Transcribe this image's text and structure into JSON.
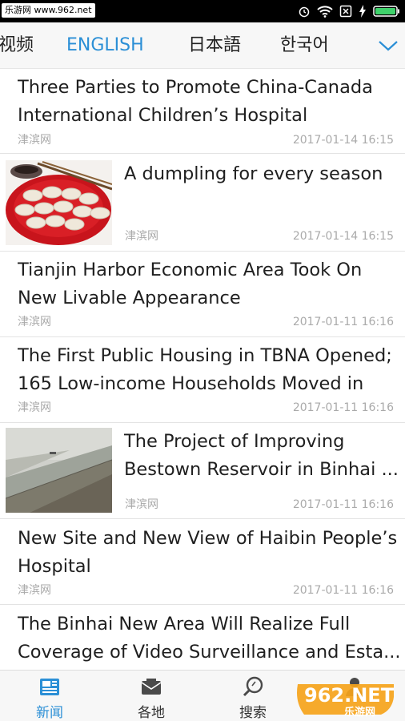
{
  "status_bar": {
    "watermark": "乐游网 www.962.net",
    "icons": [
      "alarm-icon",
      "wifi-icon",
      "no-sim-icon",
      "charging-icon",
      "battery-icon"
    ]
  },
  "tabs": [
    {
      "label": "视频",
      "active": false
    },
    {
      "label": "ENGLISH",
      "active": true
    },
    {
      "label": "日本語",
      "active": false
    },
    {
      "label": "한국어",
      "active": false
    }
  ],
  "articles": [
    {
      "title_lines": [
        "Three Parties to Promote China-Canada",
        "International Children’s Hospital"
      ],
      "source": "津滨网",
      "time": "2017-01-14 16:15"
    },
    {
      "title_lines": [
        "A dumpling for every season",
        ""
      ],
      "source": "津滨网",
      "time": "2017-01-14 16:15",
      "thumb": "dumplings-photo"
    },
    {
      "title_lines": [
        "Tianjin Harbor Economic Area Took On",
        "New Livable Appearance"
      ],
      "source": "津滨网",
      "time": "2017-01-11 16:16"
    },
    {
      "title_lines": [
        "The First Public Housing in TBNA Opened;",
        "165 Low-income Households Moved in"
      ],
      "source": "津滨网",
      "time": "2017-01-11 16:16"
    },
    {
      "title_lines": [
        "The Project of Improving",
        "Bestown Reservoir in Binhai ..."
      ],
      "source": "津滨网",
      "time": "2017-01-11 16:16",
      "thumb": "reservoir-photo"
    },
    {
      "title_lines": [
        "New Site and New View of Haibin People’s",
        "Hospital"
      ],
      "source": "津滨网",
      "time": "2017-01-11 16:16"
    },
    {
      "title_lines": [
        "The Binhai New Area Will Realize Full",
        "Coverage of Video Surveillance and Esta..."
      ],
      "source": "",
      "time": ""
    }
  ],
  "bottom_nav": [
    {
      "label": "新闻",
      "icon": "newspaper-icon",
      "active": true
    },
    {
      "label": "各地",
      "icon": "envelope-icon",
      "active": false
    },
    {
      "label": "搜索",
      "icon": "search-icon",
      "active": false
    },
    {
      "label": "",
      "icon": "user-icon",
      "active": false
    }
  ],
  "watermark_logo": {
    "text": "962.NET",
    "subtext": "乐游网"
  },
  "colors": {
    "accent": "#2b8fd6",
    "meta": "#aaaaaa",
    "divider": "#e3e3e3"
  }
}
